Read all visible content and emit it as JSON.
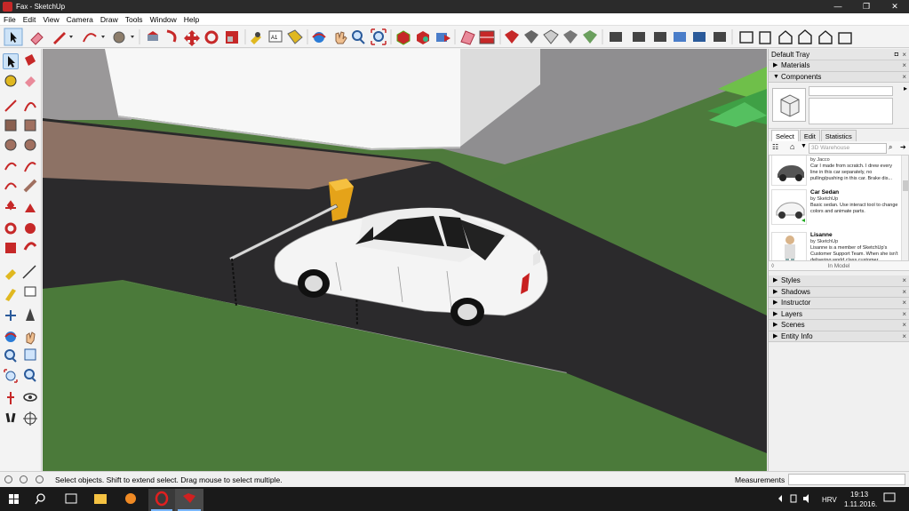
{
  "window": {
    "title": "Fax - SketchUp",
    "minimize": "—",
    "maximize": "❐",
    "close": "✕"
  },
  "menu": [
    "File",
    "Edit",
    "View",
    "Camera",
    "Draw",
    "Tools",
    "Window",
    "Help"
  ],
  "toolbar_icons": [
    "select-icon",
    "eraser-icon",
    "line-icon",
    "arc-icon",
    "shapes-icon",
    "push-pull-icon",
    "follow-me-icon",
    "move-icon",
    "rotate-icon",
    "scale-icon",
    "tape-measure-icon",
    "text-icon",
    "paint-bucket-icon",
    "orbit-icon",
    "pan-icon",
    "zoom-icon",
    "zoom-extents-icon",
    "warehouse-icon",
    "extension-warehouse-icon",
    "share-model-icon",
    "section-plane-icon",
    "section-display-icon",
    "solid-union-icon",
    "solid-subtract-icon",
    "solid-trim-icon",
    "solid-split-icon",
    "sandbox-icon",
    "layout-icon",
    "style-xray-icon",
    "style-wireframe-icon",
    "style-hidden-icon",
    "style-shaded-icon",
    "style-textured-icon",
    "style-monochrome-icon",
    "iso-view-icon",
    "front-view-icon",
    "home-view-icon",
    "top-view-icon",
    "right-view-icon",
    "back-view-icon"
  ],
  "tray": {
    "title": "Default Tray",
    "materials_label": "Materials",
    "components_label": "Components",
    "tabs": [
      "Select",
      "Edit",
      "Statistics"
    ],
    "search_placeholder": "3D Warehouse",
    "results": [
      {
        "name": "",
        "by": "by Jacco",
        "desc": "Car I made from scratch. I drew every line in this car separately, no pulling/pushing in this car. Brake dis..."
      },
      {
        "name": "Car Sedan",
        "by": "by SketchUp",
        "desc": "Basic sedan. Use interact tool to change colors and animate parts."
      },
      {
        "name": "Lisanne",
        "by": "by SketchUp",
        "desc": "Lisanne is a member of SketchUp's Customer Support Team. When she isn't delivering world class customer ..."
      }
    ],
    "in_model": "In Model",
    "panels": [
      "Styles",
      "Shadows",
      "Instructor",
      "Layers",
      "Scenes",
      "Entity Info"
    ]
  },
  "status": {
    "hint": "Select objects. Shift to extend select. Drag mouse to select multiple.",
    "measurements_label": "Measurements",
    "measurements_value": ""
  },
  "taskbar": {
    "language": "HRV",
    "time": "19:13",
    "date": "1.11.2016."
  },
  "colors": {
    "accent_selected": "#cde3f7",
    "grass": "#4d7a3c",
    "asphalt": "#2b2a2c",
    "paving": "#8f7466",
    "barrier": "#e5a319",
    "car": "#f4f4f4"
  }
}
